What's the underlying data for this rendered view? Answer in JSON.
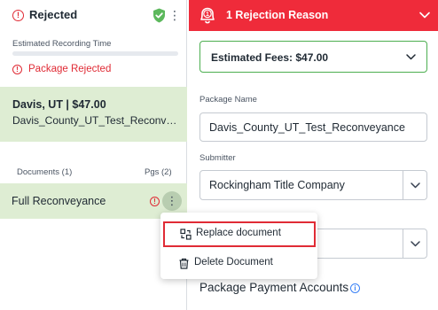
{
  "left_panel": {
    "status_title": "Rejected",
    "recording_label": "Estimated Recording Time",
    "recording_progress": 0,
    "rejected_label": "Package Rejected",
    "package": {
      "title": "Davis, UT | $47.00",
      "name": "Davis_County_UT_Test_Reconveyance"
    },
    "documents_label": "Documents (1)",
    "pages_label": "Pgs (2)",
    "document": {
      "name": "Full Reconveyance"
    }
  },
  "rejection_header": {
    "badge_count": "1",
    "text": "1 Rejection Reason"
  },
  "fees": {
    "label": "Estimated Fees: $47.00"
  },
  "form": {
    "package_name_label": "Package Name",
    "package_name_value": "Davis_County_UT_Test_Reconveyance",
    "submitter_label": "Submitter",
    "submitter_value": "Rockingham Title Company",
    "third_select_value": ""
  },
  "payment_accounts_title": "Package Payment Accounts",
  "context_menu": {
    "items": [
      {
        "label": "Replace document",
        "icon": "replace-icon"
      },
      {
        "label": "Delete Document",
        "icon": "trash-icon"
      }
    ]
  },
  "colors": {
    "danger": "#ef2b3a",
    "success": "#4caf50",
    "selected_bg": "#deedd3",
    "info": "#3b82f6"
  }
}
